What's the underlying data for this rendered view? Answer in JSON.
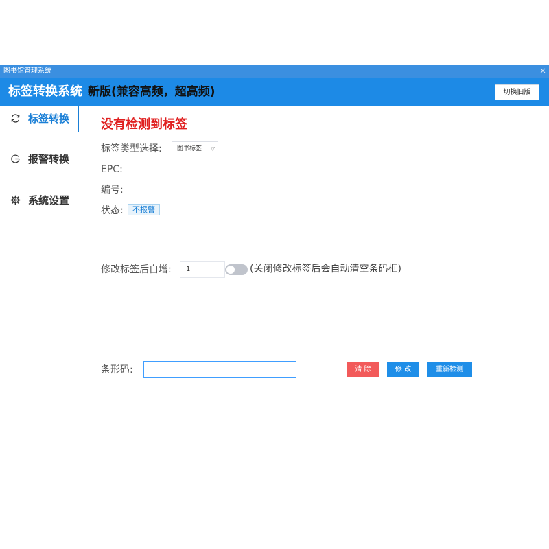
{
  "window": {
    "title": "图书馆管理系统",
    "close_symbol": "×"
  },
  "header": {
    "brand": "标签转换系统",
    "version": "新版(兼容高频，超高频)",
    "switch_button": "切换旧版"
  },
  "sidebar": {
    "items": [
      {
        "label": "标签转换",
        "icon": "refresh-icon",
        "active": true
      },
      {
        "label": "报警转换",
        "icon": "power-icon",
        "active": false
      },
      {
        "label": "系统设置",
        "icon": "gear-icon",
        "active": false
      }
    ]
  },
  "main": {
    "warning": "没有检测到标签",
    "tag_type_label": "标签类型选择:",
    "tag_type_value": "图书标签",
    "epc_label": "EPC:",
    "number_label": "编号:",
    "status_label": "状态:",
    "status_value": "不报警",
    "auto_increment_label": "修改标签后自增:",
    "auto_increment_value": "1",
    "toggle_on": false,
    "toggle_hint": "(关闭修改标签后会自动清空条码框)",
    "barcode_label": "条形码:",
    "barcode_value": "",
    "buttons": {
      "clear": "清 除",
      "modify": "修 改",
      "redetect": "重新检测"
    }
  },
  "colors": {
    "titlebar": "#3b8fe0",
    "header": "#1d8ae6",
    "accent": "#1a7fd6",
    "warning": "#e02020",
    "danger_button": "#f25a5a",
    "primary_button": "#1f8ee8"
  }
}
